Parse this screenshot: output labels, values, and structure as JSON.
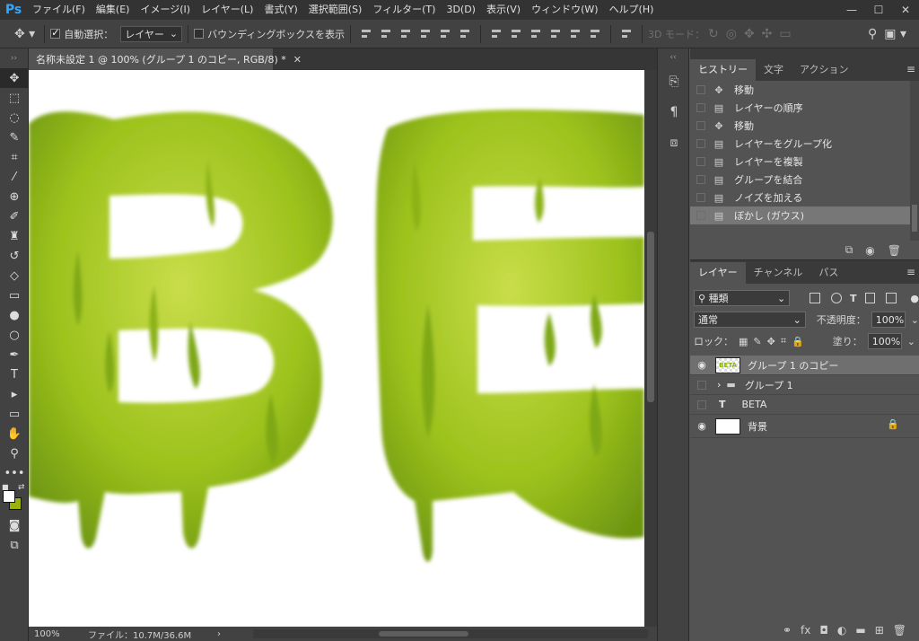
{
  "app": {
    "logo": "Ps"
  },
  "menu": [
    "ファイル(F)",
    "編集(E)",
    "イメージ(I)",
    "レイヤー(L)",
    "書式(Y)",
    "選択範囲(S)",
    "フィルター(T)",
    "3D(D)",
    "表示(V)",
    "ウィンドウ(W)",
    "ヘルプ(H)"
  ],
  "window_controls": {
    "minimize": "—",
    "maximize": "☐",
    "close": "✕"
  },
  "options": {
    "auto_select_label": "自動選択：",
    "auto_select_checked": true,
    "target_value": "レイヤー",
    "bounding_box_label": "バウンディングボックスを表示",
    "mode_3d_label": "3D モード："
  },
  "document": {
    "tab_title": "名称未設定 1 @ 100% (グループ 1 のコピー, RGB/8) *",
    "zoom": "100%",
    "file_info": "ファイル：10.7M/36.6M",
    "canvas_text": "BE"
  },
  "tools": [
    {
      "name": "move-tool",
      "glyph": "✥"
    },
    {
      "name": "marquee-tool",
      "glyph": "⬚"
    },
    {
      "name": "lasso-tool",
      "glyph": "◌"
    },
    {
      "name": "quick-select-tool",
      "glyph": "✎"
    },
    {
      "name": "crop-tool",
      "glyph": "⌗"
    },
    {
      "name": "eyedropper-tool",
      "glyph": "⁄"
    },
    {
      "name": "healing-tool",
      "glyph": "⊕"
    },
    {
      "name": "brush-tool",
      "glyph": "✐"
    },
    {
      "name": "stamp-tool",
      "glyph": "♜"
    },
    {
      "name": "history-brush-tool",
      "glyph": "↺"
    },
    {
      "name": "eraser-tool",
      "glyph": "◇"
    },
    {
      "name": "gradient-tool",
      "glyph": "▭"
    },
    {
      "name": "blur-tool",
      "glyph": "●"
    },
    {
      "name": "dodge-tool",
      "glyph": "○"
    },
    {
      "name": "pen-tool",
      "glyph": "✒"
    },
    {
      "name": "type-tool",
      "glyph": "T"
    },
    {
      "name": "path-select-tool",
      "glyph": "▸"
    },
    {
      "name": "shape-tool",
      "glyph": "▭"
    },
    {
      "name": "hand-tool",
      "glyph": "✋"
    },
    {
      "name": "zoom-tool",
      "glyph": "⚲"
    },
    {
      "name": "more-tools",
      "glyph": "•••"
    }
  ],
  "colors": {
    "foreground": "#ffffff",
    "background": "#9ab10e",
    "slime_light": "#b9d33a",
    "slime_dark": "#6f9a10"
  },
  "history": {
    "tabs": [
      "ヒストリー",
      "文字",
      "アクション"
    ],
    "items": [
      {
        "label": "移動",
        "icon": "✥"
      },
      {
        "label": "レイヤーの順序",
        "icon": "▤"
      },
      {
        "label": "移動",
        "icon": "✥"
      },
      {
        "label": "レイヤーをグループ化",
        "icon": "▤"
      },
      {
        "label": "レイヤーを複製",
        "icon": "▤"
      },
      {
        "label": "グループを結合",
        "icon": "▤"
      },
      {
        "label": "ノイズを加える",
        "icon": "▤"
      },
      {
        "label": "ぼかし (ガウス)",
        "icon": "▤"
      }
    ]
  },
  "layers": {
    "tabs": [
      "レイヤー",
      "チャンネル",
      "パス"
    ],
    "filter_label": "種類",
    "blend_mode": "通常",
    "opacity_label": "不透明度：",
    "opacity_value": "100%",
    "lock_label": "ロック：",
    "fill_label": "塗り：",
    "fill_value": "100%",
    "items": [
      {
        "name": "グループ 1 のコピー",
        "visible": true,
        "type": "raster",
        "selected": true
      },
      {
        "name": "グループ 1",
        "visible": false,
        "type": "group",
        "selected": false
      },
      {
        "name": "BETA",
        "visible": false,
        "type": "text",
        "selected": false
      },
      {
        "name": "背景",
        "visible": true,
        "type": "background",
        "selected": false
      }
    ],
    "thumb_text": "BETA"
  }
}
